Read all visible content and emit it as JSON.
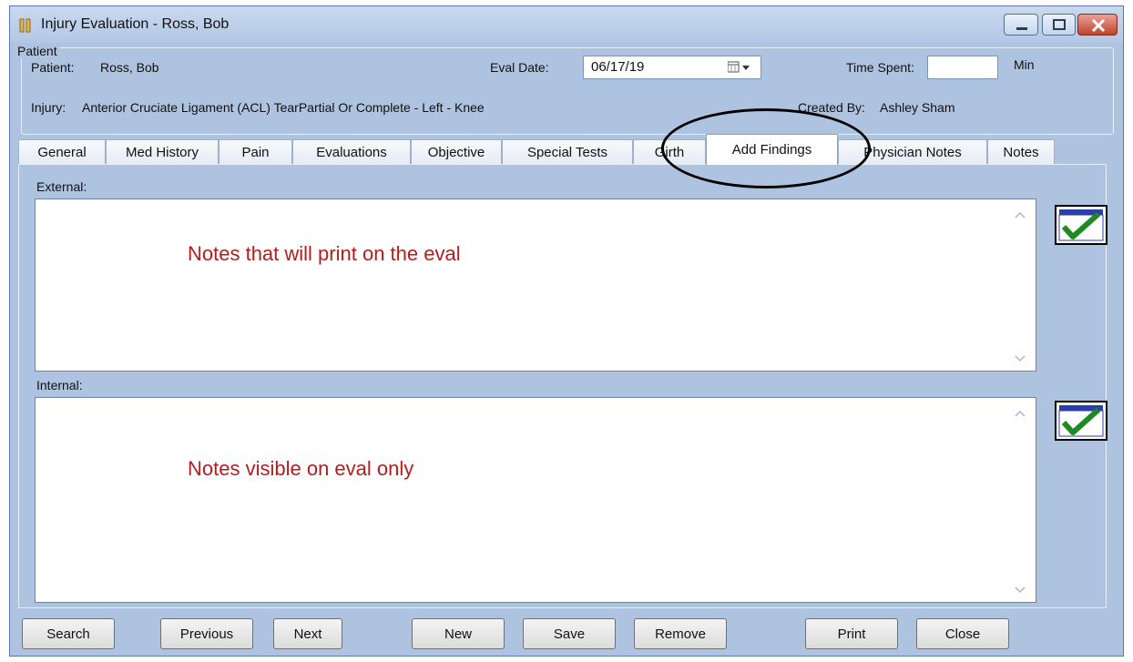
{
  "window": {
    "title": "Injury Evaluation - Ross, Bob"
  },
  "patient_group": {
    "title": "Patient",
    "patient_label": "Patient:",
    "patient_value": "Ross, Bob",
    "eval_date_label": "Eval Date:",
    "eval_date_value": "06/17/19",
    "time_spent_label": "Time Spent:",
    "time_spent_value": "",
    "time_spent_unit": "Min",
    "injury_label": "Injury:",
    "injury_value": "Anterior Cruciate Ligament (ACL) TearPartial Or Complete - Left - Knee",
    "created_by_label": "Created By:",
    "created_by_value": "Ashley Sham"
  },
  "tabs": [
    {
      "label": "General"
    },
    {
      "label": "Med History"
    },
    {
      "label": "Pain"
    },
    {
      "label": "Evaluations"
    },
    {
      "label": "Objective"
    },
    {
      "label": "Special Tests"
    },
    {
      "label": "Girth"
    },
    {
      "label": "Add Findings"
    },
    {
      "label": "Physician Notes"
    },
    {
      "label": "Notes"
    }
  ],
  "active_tab": "Add Findings",
  "external": {
    "label": "External:",
    "annotation": "Notes that will print on the eval"
  },
  "internal": {
    "label": "Internal:",
    "annotation": "Notes visible on eval only"
  },
  "buttons": {
    "search": "Search",
    "previous": "Previous",
    "next": "Next",
    "new": "New",
    "save": "Save",
    "remove": "Remove",
    "print": "Print",
    "close": "Close"
  },
  "colors": {
    "window_bg": "#aec3e0",
    "annotation_text": "#b31d1d",
    "check_green": "#1f8a1f"
  }
}
